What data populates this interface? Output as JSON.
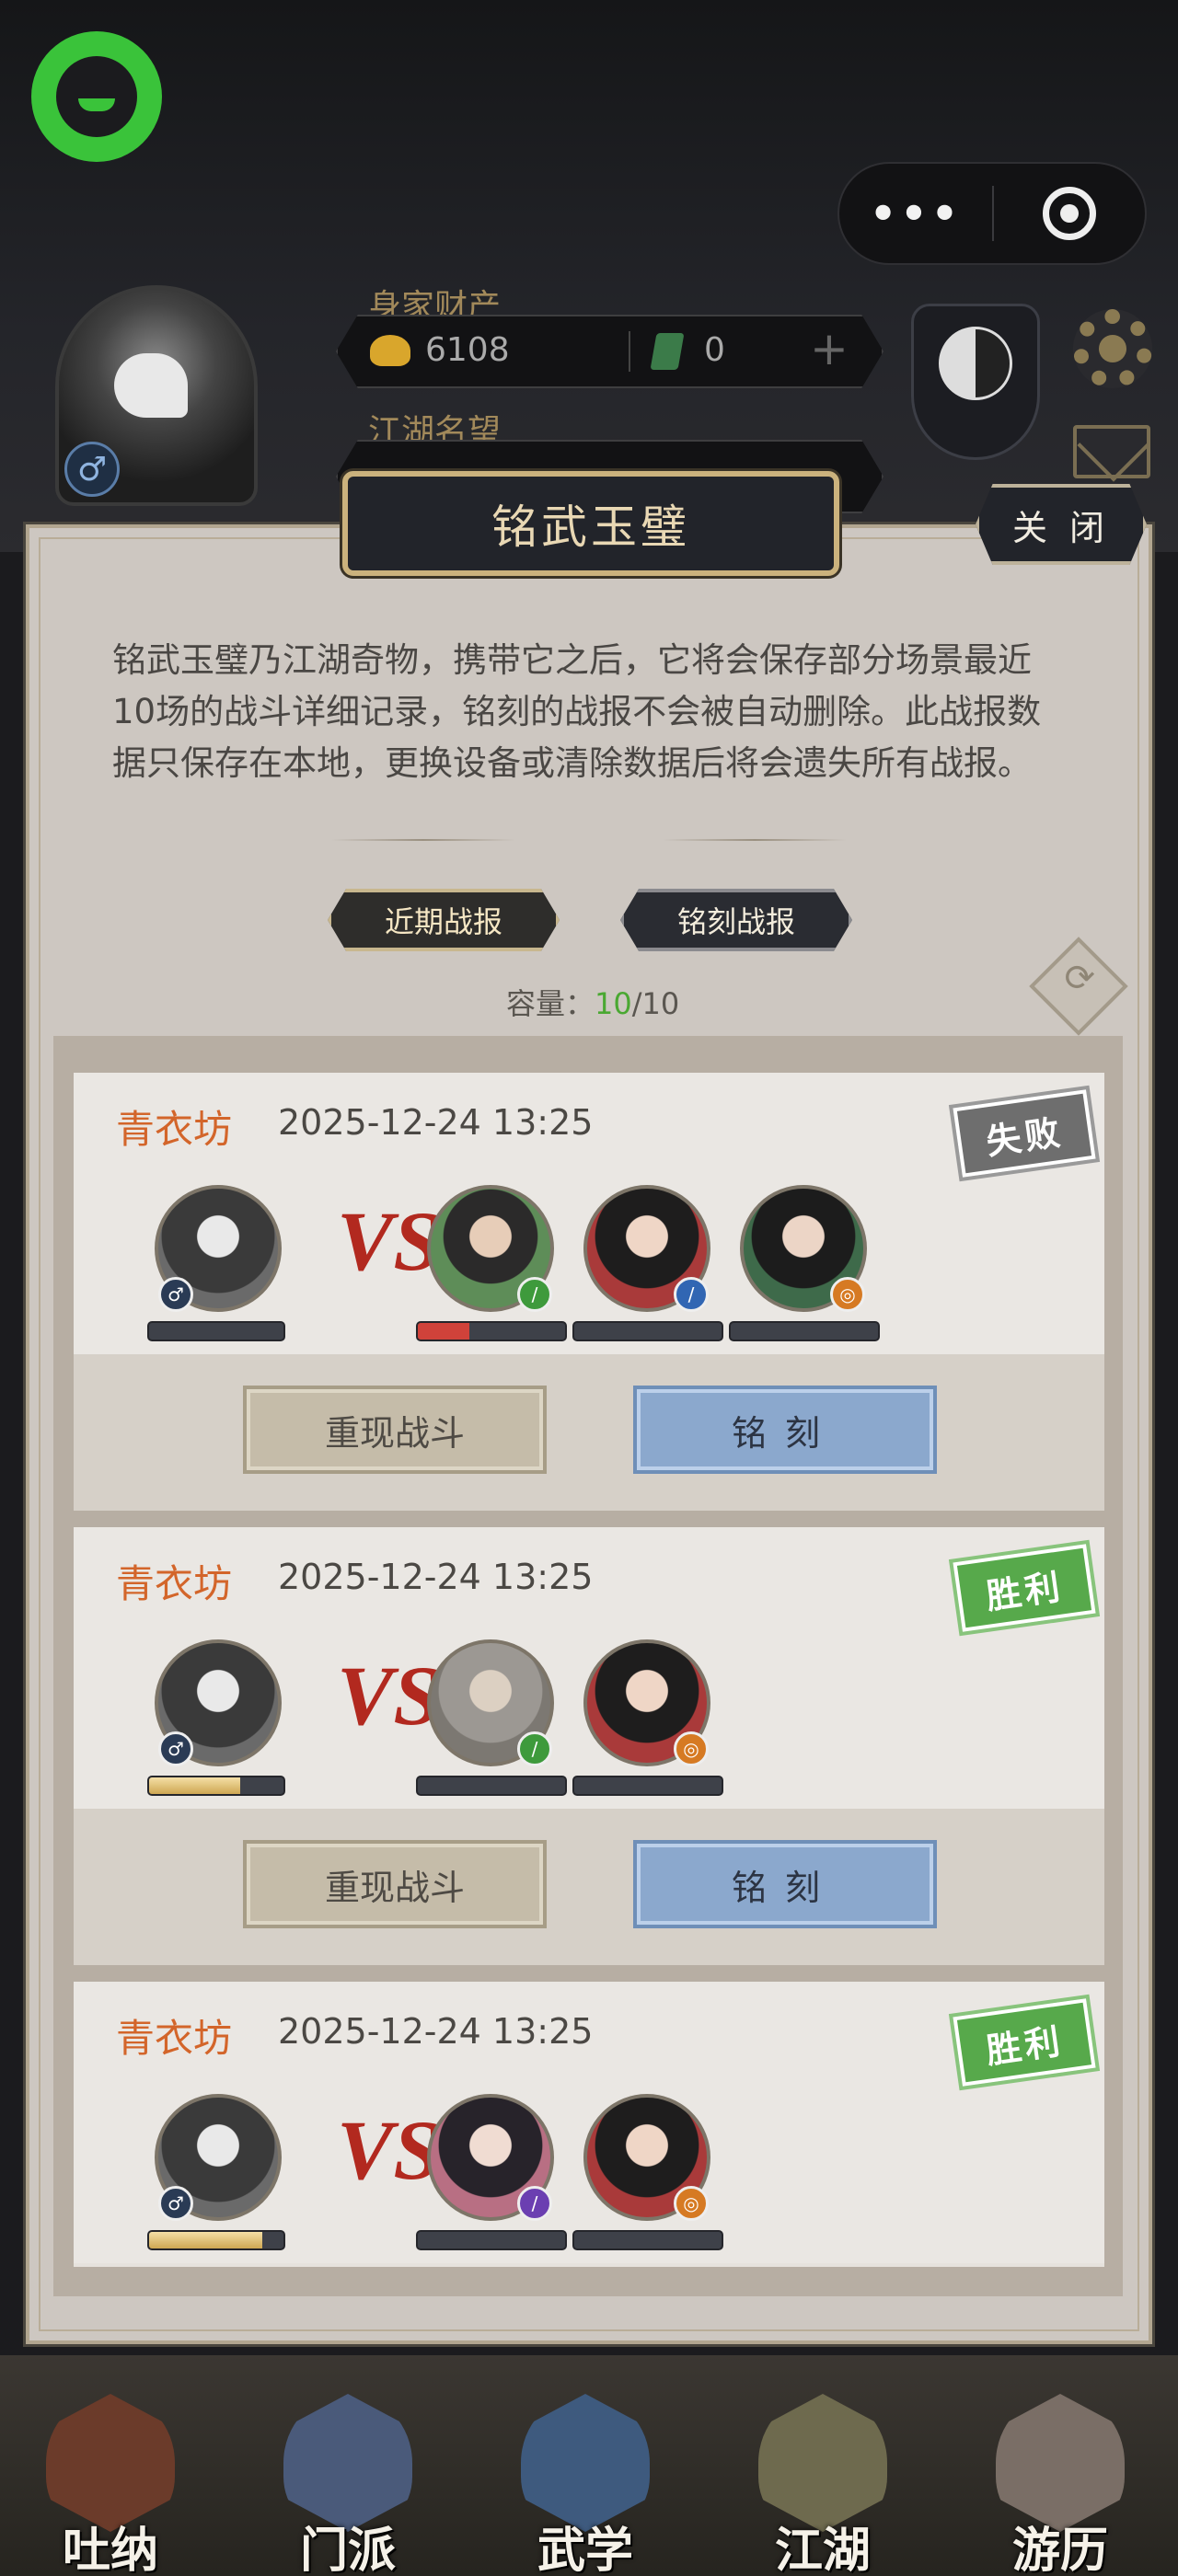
{
  "header": {
    "wealth_label": "身家财产",
    "gold_value": "6108",
    "jade_value": "0",
    "reputation_label": "江湖名望",
    "plus_symbol": "+"
  },
  "capsule": {
    "more_label": "•••"
  },
  "modal": {
    "title": "铭武玉璧",
    "close_label": "关 闭",
    "description": "铭武玉璧乃江湖奇物，携带它之后，它将会保存部分场景最近10场的战斗详细记录，铭刻的战报不会被自动删除。此战报数据只保存在本地，更换设备或清除数据后将会遗失所有战报。",
    "tabs": [
      {
        "label": "近期战报",
        "active": true
      },
      {
        "label": "铭刻战报",
        "active": false
      }
    ],
    "capacity_label": "容量：",
    "capacity_used": "10",
    "capacity_total": "/10"
  },
  "records": [
    {
      "location": "青衣坊",
      "time": "2025-12-24 13:25",
      "result": "失败",
      "result_type": "lose",
      "my_hp": 0.0,
      "enemy_hp": [
        0.35,
        0.0,
        0.0
      ],
      "replay_label": "重现战斗",
      "engrave_label": "铭刻"
    },
    {
      "location": "青衣坊",
      "time": "2025-12-24 13:25",
      "result": "胜利",
      "result_type": "win",
      "my_hp": 0.68,
      "enemy_hp": [
        0.0,
        0.0
      ],
      "replay_label": "重现战斗",
      "engrave_label": "铭刻"
    },
    {
      "location": "青衣坊",
      "time": "2025-12-24 13:25",
      "result": "胜利",
      "result_type": "win",
      "my_hp": 0.84,
      "enemy_hp": [
        0.0,
        0.0
      ]
    }
  ],
  "vs_label": "VS",
  "nav": [
    "吐纳",
    "门派",
    "武学",
    "江湖",
    "游历"
  ],
  "colors": {
    "lose_stamp": "#6e6e6e",
    "win_stamp": "#57a94b",
    "location_text": "#d3652a",
    "engrave_button": "#8ba8cd",
    "capacity_used": "#4aa832"
  }
}
